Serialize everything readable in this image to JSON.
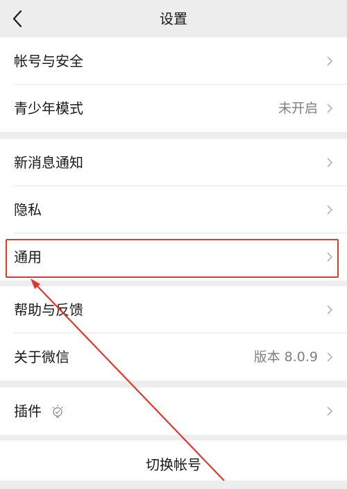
{
  "nav": {
    "title": "设置"
  },
  "groups": [
    {
      "items": [
        {
          "label": "帐号与安全",
          "value": ""
        },
        {
          "label": "青少年模式",
          "value": "未开启"
        }
      ]
    },
    {
      "items": [
        {
          "label": "新消息通知",
          "value": ""
        },
        {
          "label": "隐私",
          "value": ""
        },
        {
          "label": "通用",
          "value": ""
        }
      ]
    },
    {
      "items": [
        {
          "label": "帮助与反馈",
          "value": ""
        },
        {
          "label": "关于微信",
          "value": "版本 8.0.9"
        }
      ]
    },
    {
      "items": [
        {
          "label": "插件",
          "value": ""
        }
      ]
    }
  ],
  "footer": {
    "switch_account": "切换帐号"
  },
  "annotation": {
    "color": "#e0392b",
    "highlighted_item": "通用"
  },
  "icons": {
    "back": "chevron-left-icon",
    "row_arrow": "chevron-right-icon",
    "plugin": "lightbulb-icon"
  }
}
